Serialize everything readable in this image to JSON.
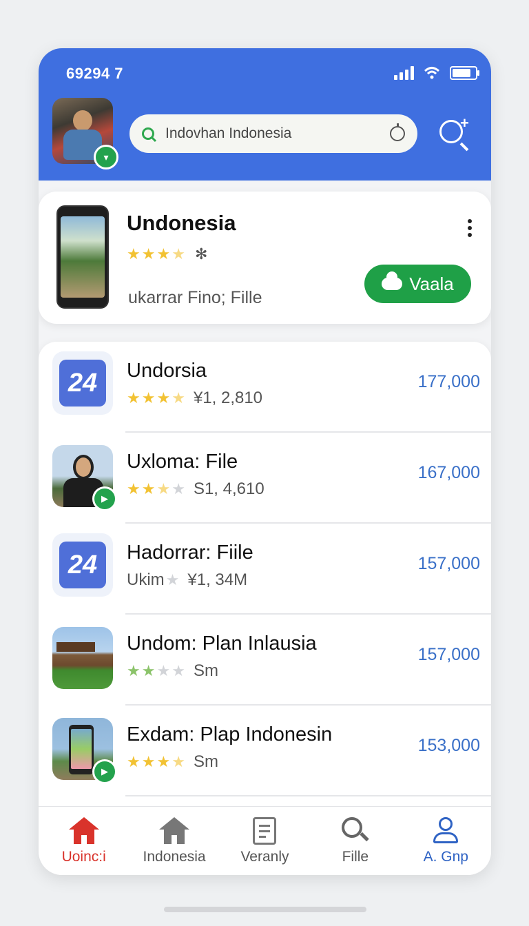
{
  "status": {
    "time": "69294 7"
  },
  "search": {
    "value": "Indovhan Indonesia"
  },
  "featured": {
    "title": "Undonesia",
    "rating_extra": "✻",
    "subtitle": "ukarrar Fino; Fille",
    "button_label": "Vaala"
  },
  "list": [
    {
      "title": "Undorsia",
      "meta": "¥1, 2,810",
      "value": "177,000",
      "icon": "24-app-icon"
    },
    {
      "title": "Uxloma: File",
      "meta": "S1, 4,610",
      "value": "167,000",
      "icon": "person-thumbnail"
    },
    {
      "title": "Hadorrar: Fiile",
      "meta_prefix": "Ukim",
      "meta": "¥1, 34M",
      "value": "157,000",
      "icon": "24-app-icon"
    },
    {
      "title": "Undom: Plan Inlausia",
      "meta": "Sm",
      "value": "157,000",
      "icon": "house-thumbnail"
    },
    {
      "title": "Exdam: Plap Indonesin",
      "meta": "Sm",
      "value": "153,000",
      "icon": "phone-thumbnail"
    }
  ],
  "tabs": [
    {
      "label": "Uoinc:i",
      "icon": "home-icon"
    },
    {
      "label": "Indonesia",
      "icon": "home-icon"
    },
    {
      "label": "Veranly",
      "icon": "document-icon"
    },
    {
      "label": "Fille",
      "icon": "search-icon"
    },
    {
      "label": "A. Gnp",
      "icon": "person-icon"
    }
  ],
  "colors": {
    "header": "#3f6fe0",
    "accent_green": "#1fa047",
    "value_blue": "#3a70c8",
    "active_tab": "#d9332b"
  }
}
